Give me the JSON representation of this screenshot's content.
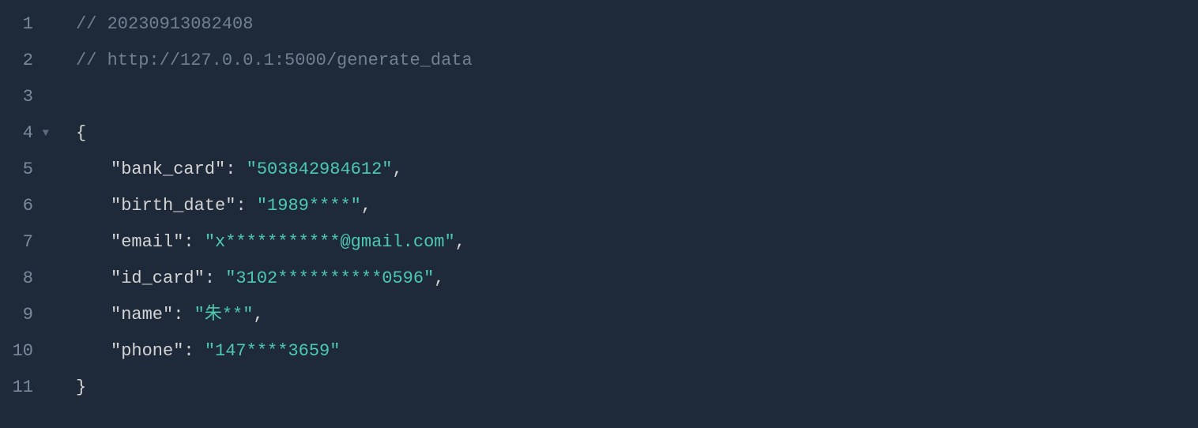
{
  "lines": {
    "l1_num": "1",
    "l2_num": "2",
    "l3_num": "3",
    "l4_num": "4",
    "l5_num": "5",
    "l6_num": "6",
    "l7_num": "7",
    "l8_num": "8",
    "l9_num": "9",
    "l10_num": "10",
    "l11_num": "11"
  },
  "fold_marker": "▼",
  "comments": {
    "timestamp": "// 20230913082408",
    "url": "// http://127.0.0.1:5000/generate_data"
  },
  "json": {
    "open_brace": "{",
    "close_brace": "}",
    "keys": {
      "bank_card": "\"bank_card\"",
      "birth_date": "\"birth_date\"",
      "email": "\"email\"",
      "id_card": "\"id_card\"",
      "name": "\"name\"",
      "phone": "\"phone\""
    },
    "values": {
      "bank_card": "\"503842984612\"",
      "birth_date": "\"1989****\"",
      "email": "\"x***********@gmail.com\"",
      "id_card": "\"3102**********0596\"",
      "name": "\"朱**\"",
      "phone": "\"147****3659\""
    },
    "colon": ":",
    "comma": ",",
    "space": " "
  }
}
